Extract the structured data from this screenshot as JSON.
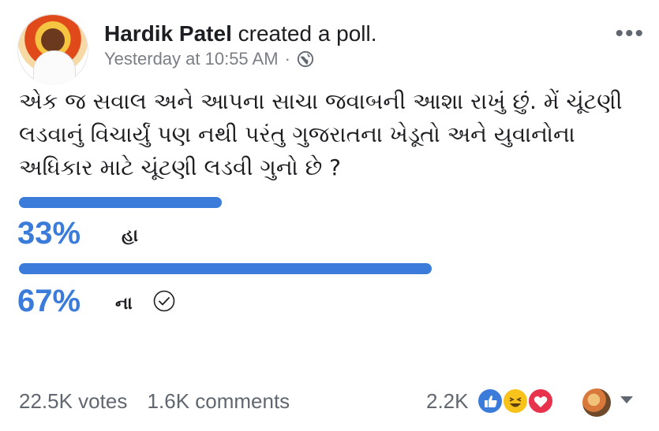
{
  "post": {
    "author": "Hardik Patel",
    "action": "created a poll.",
    "timestamp": "Yesterday at 10:55 AM",
    "separator": "·",
    "question": "એક જ સવાલ અને આપના સાચા જવાબની આશા રાખું છું. મેં ચૂંટણી લડવાનું વિચાર્યું પણ નથી પરંતુ ગુજરાતના ખેડૂતો અને યુવાનોના અધિકાર માટે ચૂંટણી લડવી ગુનો છે ?",
    "more": "•••"
  },
  "poll": {
    "options": [
      {
        "percent_text": "33%",
        "label": "હા",
        "fraction": 0.33,
        "checked": false
      },
      {
        "percent_text": "67%",
        "label": "ના",
        "fraction": 0.67,
        "checked": true
      }
    ],
    "accent_color": "#3b7cdb"
  },
  "footer": {
    "votes": "22.5K votes",
    "comments": "1.6K comments",
    "reaction_count": "2.2K",
    "reactions": [
      "like-icon",
      "haha-icon",
      "love-icon"
    ]
  },
  "colors": {
    "text": "#1c1e21",
    "meta": "#7a7e85",
    "like": "#3b7cdb",
    "haha": "#f7c31b",
    "love": "#e8334c"
  }
}
